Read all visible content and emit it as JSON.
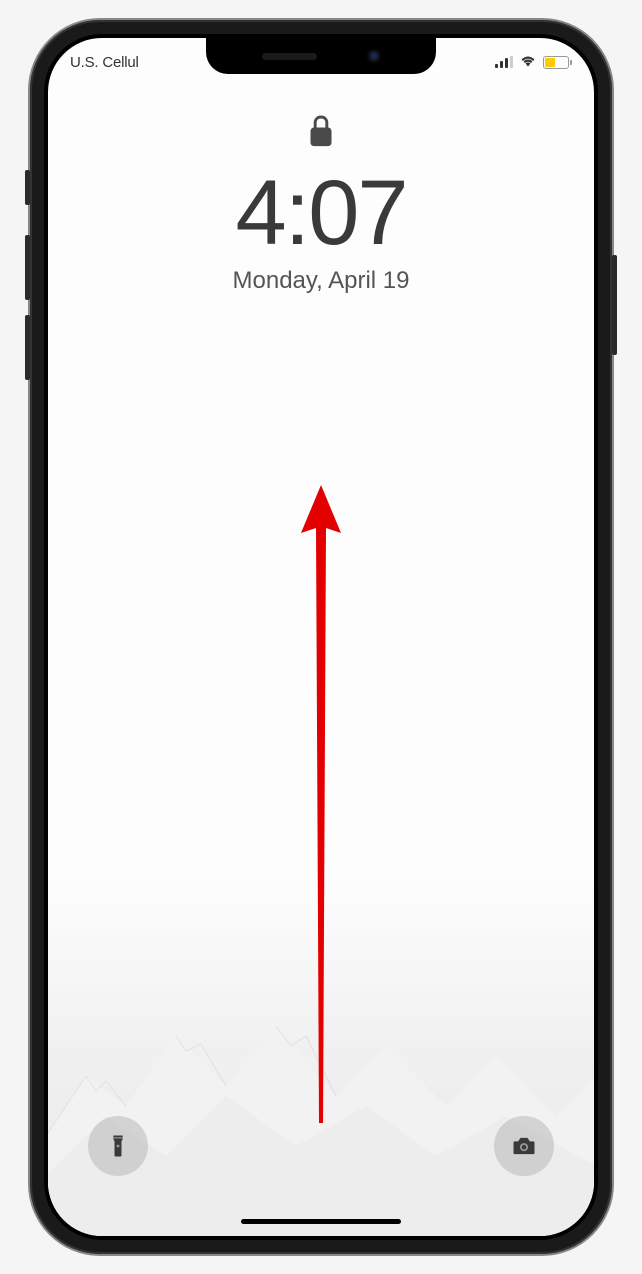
{
  "statusBar": {
    "carrier": "U.S. Cellul",
    "signalStrength": 3,
    "wifiConnected": true,
    "batteryLevel": 45,
    "batteryColor": "#ffcc00"
  },
  "lockScreen": {
    "time": "4:07",
    "date": "Monday, April 19"
  },
  "controls": {
    "flashlight": "flashlight",
    "camera": "camera"
  },
  "annotation": {
    "type": "swipe-up-arrow",
    "color": "#e30000"
  }
}
